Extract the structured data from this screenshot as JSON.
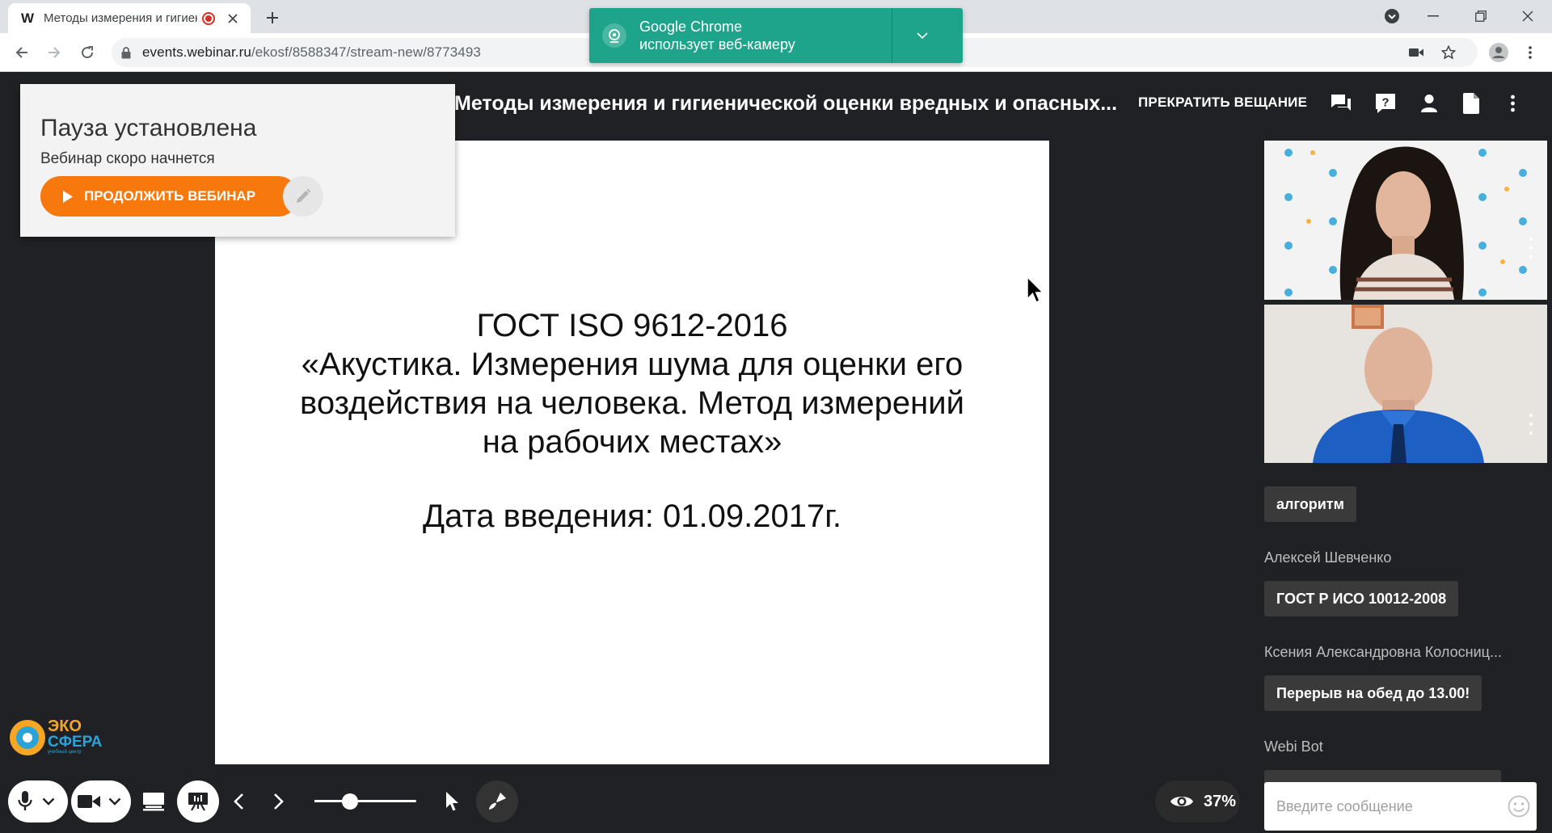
{
  "browser": {
    "tab": {
      "favicon": "W",
      "title": "Методы измерения и гигиен"
    },
    "url": {
      "domain": "events.webinar.ru",
      "path": "/ekosf/8588347/stream-new/8773493"
    }
  },
  "notification": {
    "line1": "Google Chrome",
    "line2": "использует веб-камеру"
  },
  "webinar": {
    "title": "Методы измерения и гигиенической оценки вредных и опасных...",
    "stop_label": "ПРЕКРАТИТЬ ВЕЩАНИЕ"
  },
  "pause": {
    "title": "Пауза установлена",
    "subtitle": "Вебинар скоро начнется",
    "continue_label": "ПРОДОЛЖИТЬ ВЕБИНАР"
  },
  "slide": {
    "lines": [
      "ГОСТ ISO 9612-2016",
      "«Акустика. Измерения шума для оценки его",
      "воздействия на человека. Метод измерений",
      "на рабочих местах»"
    ],
    "date": "Дата введения: 01.09.2017г."
  },
  "logo": {
    "word1": "ЭКО",
    "word2": "СФЕРА",
    "tagline": "учебный центр"
  },
  "controls": {
    "zoom_level": 0.35,
    "load_percent": "37%"
  },
  "chat": {
    "messages": [
      {
        "author": "",
        "text": "алгоритм"
      },
      {
        "author": "Алексей Шевченко",
        "text": "ГОСТ Р ИСО 10012-2008"
      },
      {
        "author": "Ксения Александровна Колосниц...",
        "text": "Перерыв на обед до 13.00!"
      },
      {
        "author": "Webi Bot",
        "text": ""
      }
    ],
    "input_placeholder": "Введите сообщение"
  },
  "colors": {
    "accent": "#f7780d",
    "notification": "#1ea48b",
    "background": "#202124"
  }
}
